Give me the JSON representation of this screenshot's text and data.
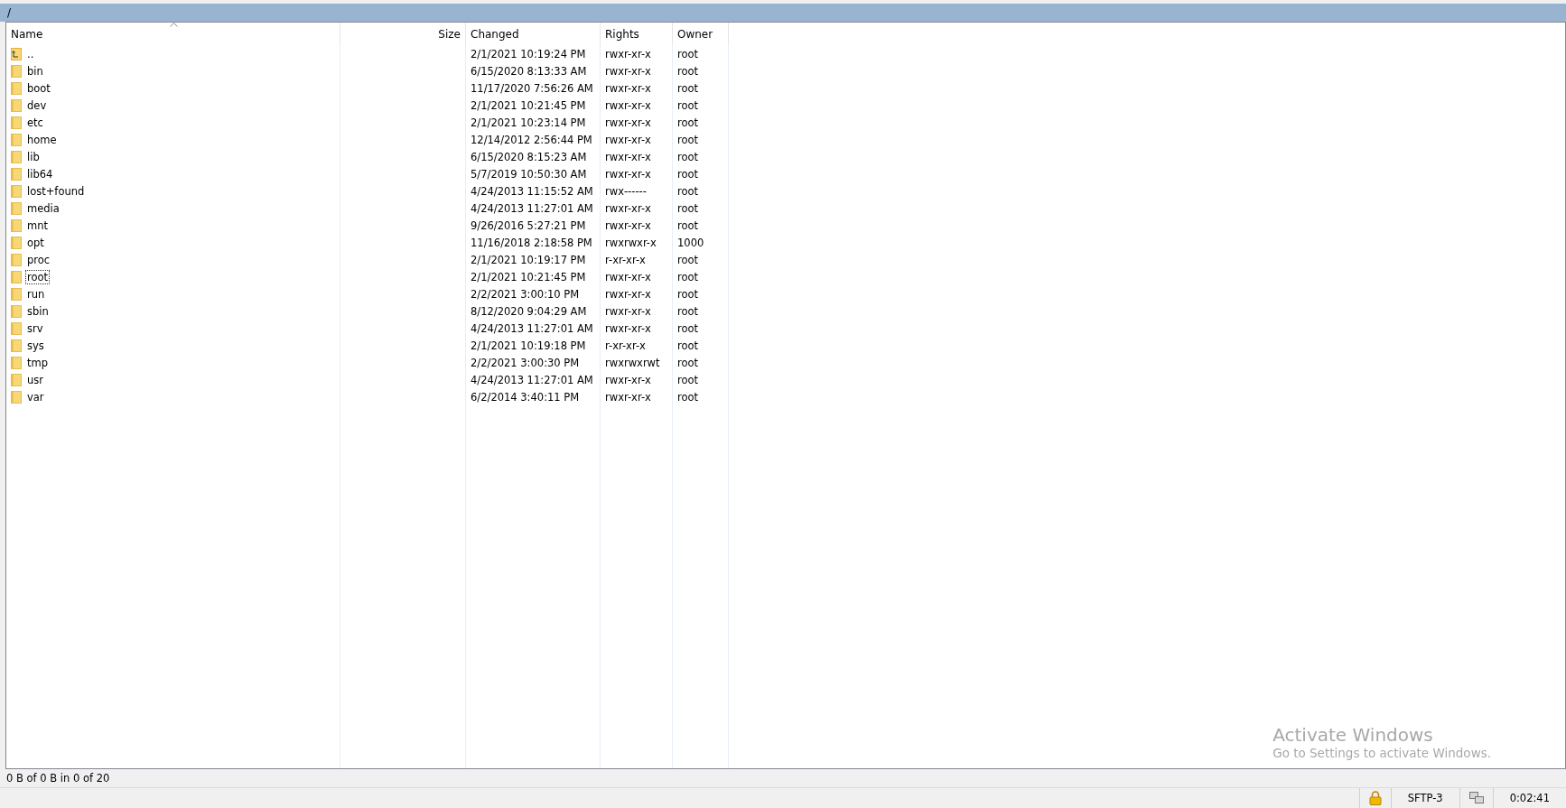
{
  "path_bar": {
    "path": "/"
  },
  "table": {
    "columns": [
      {
        "label": "Name",
        "kind": "text",
        "sorted": true
      },
      {
        "label": "Size",
        "kind": "number",
        "sorted": false
      },
      {
        "label": "Changed",
        "kind": "text",
        "sorted": false
      },
      {
        "label": "Rights",
        "kind": "text",
        "sorted": false
      },
      {
        "label": "Owner",
        "kind": "text",
        "sorted": false
      }
    ],
    "rows": [
      {
        "kind": "parent",
        "name": "..",
        "changed": "2/1/2021 10:19:24 PM",
        "rights": "rwxr-xr-x",
        "owner": "root",
        "focused": false
      },
      {
        "kind": "folder",
        "name": "bin",
        "changed": "6/15/2020 8:13:33 AM",
        "rights": "rwxr-xr-x",
        "owner": "root",
        "focused": false
      },
      {
        "kind": "folder",
        "name": "boot",
        "changed": "11/17/2020 7:56:26 AM",
        "rights": "rwxr-xr-x",
        "owner": "root",
        "focused": false
      },
      {
        "kind": "folder",
        "name": "dev",
        "changed": "2/1/2021 10:21:45 PM",
        "rights": "rwxr-xr-x",
        "owner": "root",
        "focused": false
      },
      {
        "kind": "folder",
        "name": "etc",
        "changed": "2/1/2021 10:23:14 PM",
        "rights": "rwxr-xr-x",
        "owner": "root",
        "focused": false
      },
      {
        "kind": "folder",
        "name": "home",
        "changed": "12/14/2012 2:56:44 PM",
        "rights": "rwxr-xr-x",
        "owner": "root",
        "focused": false
      },
      {
        "kind": "folder",
        "name": "lib",
        "changed": "6/15/2020 8:15:23 AM",
        "rights": "rwxr-xr-x",
        "owner": "root",
        "focused": false
      },
      {
        "kind": "folder",
        "name": "lib64",
        "changed": "5/7/2019 10:50:30 AM",
        "rights": "rwxr-xr-x",
        "owner": "root",
        "focused": false
      },
      {
        "kind": "folder",
        "name": "lost+found",
        "changed": "4/24/2013 11:15:52 AM",
        "rights": "rwx------",
        "owner": "root",
        "focused": false
      },
      {
        "kind": "folder",
        "name": "media",
        "changed": "4/24/2013 11:27:01 AM",
        "rights": "rwxr-xr-x",
        "owner": "root",
        "focused": false
      },
      {
        "kind": "folder",
        "name": "mnt",
        "changed": "9/26/2016 5:27:21 PM",
        "rights": "rwxr-xr-x",
        "owner": "root",
        "focused": false
      },
      {
        "kind": "folder",
        "name": "opt",
        "changed": "11/16/2018 2:18:58 PM",
        "rights": "rwxrwxr-x",
        "owner": "1000",
        "focused": false
      },
      {
        "kind": "folder",
        "name": "proc",
        "changed": "2/1/2021 10:19:17 PM",
        "rights": "r-xr-xr-x",
        "owner": "root",
        "focused": false
      },
      {
        "kind": "folder",
        "name": "root",
        "changed": "2/1/2021 10:21:45 PM",
        "rights": "rwxr-xr-x",
        "owner": "root",
        "focused": true
      },
      {
        "kind": "folder",
        "name": "run",
        "changed": "2/2/2021 3:00:10 PM",
        "rights": "rwxr-xr-x",
        "owner": "root",
        "focused": false
      },
      {
        "kind": "folder",
        "name": "sbin",
        "changed": "8/12/2020 9:04:29 AM",
        "rights": "rwxr-xr-x",
        "owner": "root",
        "focused": false
      },
      {
        "kind": "folder",
        "name": "srv",
        "changed": "4/24/2013 11:27:01 AM",
        "rights": "rwxr-xr-x",
        "owner": "root",
        "focused": false
      },
      {
        "kind": "folder",
        "name": "sys",
        "changed": "2/1/2021 10:19:18 PM",
        "rights": "r-xr-xr-x",
        "owner": "root",
        "focused": false
      },
      {
        "kind": "folder",
        "name": "tmp",
        "changed": "2/2/2021 3:00:30 PM",
        "rights": "rwxrwxrwt",
        "owner": "root",
        "focused": false
      },
      {
        "kind": "folder",
        "name": "usr",
        "changed": "4/24/2013 11:27:01 AM",
        "rights": "rwxr-xr-x",
        "owner": "root",
        "focused": false
      },
      {
        "kind": "folder",
        "name": "var",
        "changed": "6/2/2014 3:40:11 PM",
        "rights": "rwxr-xr-x",
        "owner": "root",
        "focused": false
      }
    ]
  },
  "os_notice": {
    "title": "Activate Windows",
    "message": "Go to Settings to activate Windows."
  },
  "selection_summary": "0 B of 0 B in 0 of 20",
  "status_bar": {
    "protocol": "SFTP-3",
    "elapsed": "0:02:41"
  }
}
